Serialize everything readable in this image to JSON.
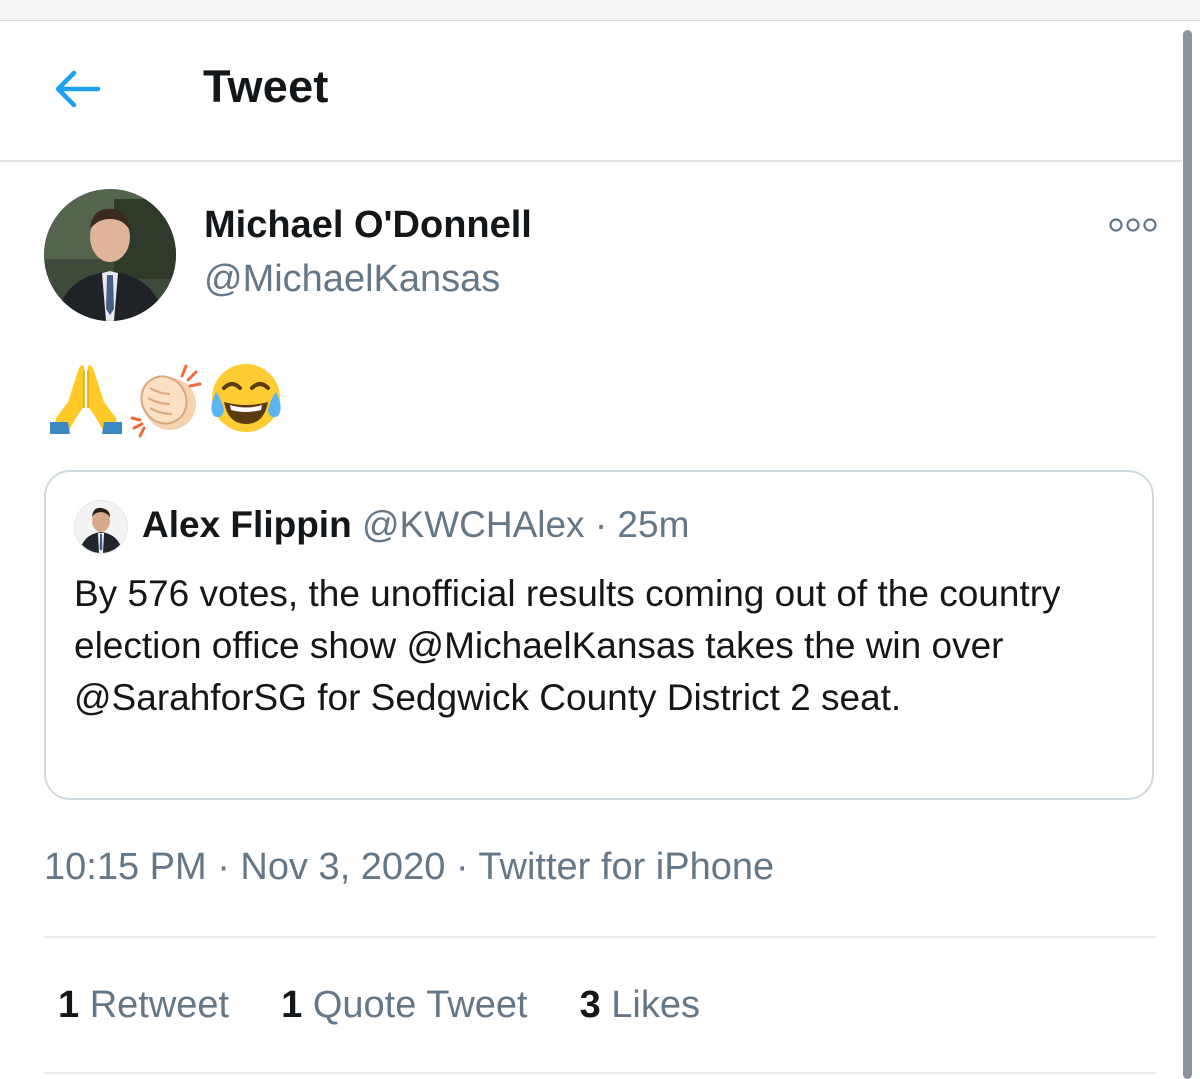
{
  "header": {
    "title": "Tweet",
    "back_icon": "back-arrow-icon"
  },
  "colors": {
    "accent": "#1da1f2",
    "text_primary": "#14171a",
    "text_secondary": "#657786",
    "border": "#cfd9de"
  },
  "tweet": {
    "author_name": "Michael O'Donnell",
    "author_handle": "@MichaelKansas",
    "more_icon": "more-options-icon",
    "emojis": [
      "folded-hands-emoji",
      "clapping-hands-emoji",
      "tears-of-joy-emoji"
    ],
    "quoted": {
      "author_name": "Alex Flippin",
      "meta": "@KWCHAlex · 25m",
      "text": "By 576 votes, the unofficial results coming out of the country election office show @MichaelKansas takes the win over @SarahforSG for Sedgwick County District 2 seat."
    },
    "time": "10:15 PM · Nov 3, 2020 · ",
    "source": "Twitter for iPhone",
    "stats": {
      "retweets_count": "1",
      "retweets_label": "Retweet",
      "quotes_count": "1",
      "quotes_label": "Quote Tweet",
      "likes_count": "3",
      "likes_label": "Likes"
    }
  }
}
